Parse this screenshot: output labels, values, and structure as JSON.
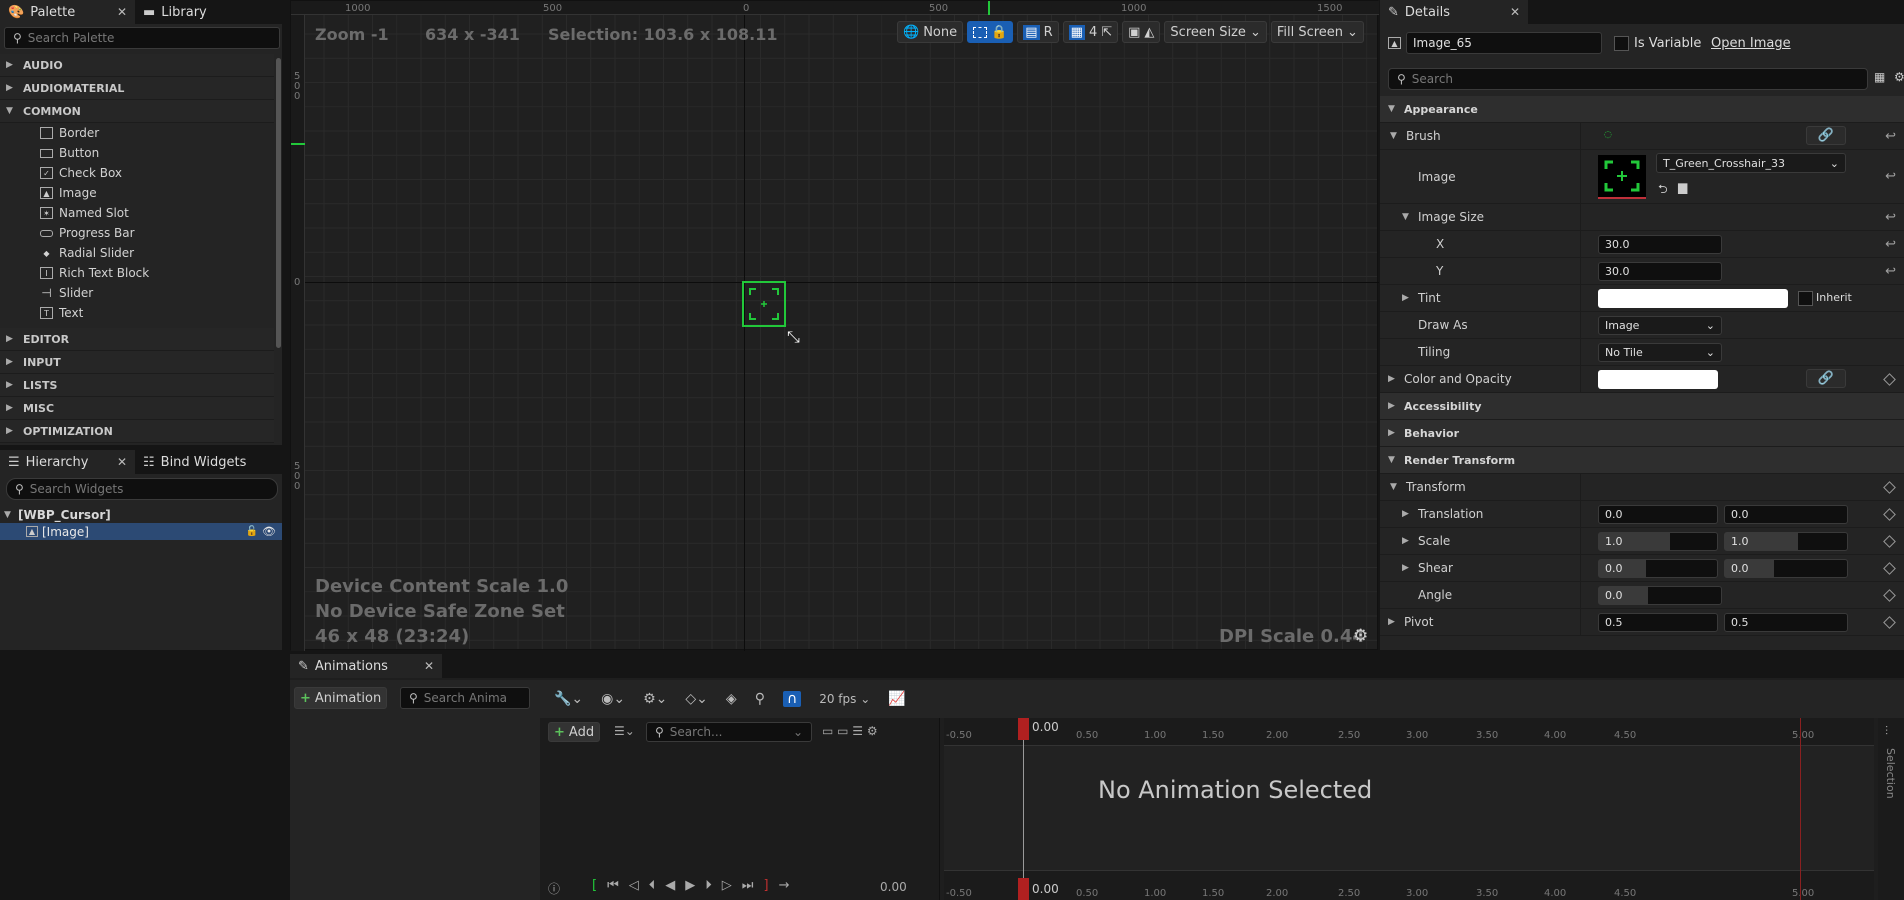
{
  "palette": {
    "tab_label": "Palette",
    "library_tab_label": "Library",
    "search_placeholder": "Search Palette",
    "categories_top": [
      "AUDIO",
      "AUDIOMATERIAL",
      "COMMON"
    ],
    "common_items": [
      {
        "label": "Border",
        "icon": "border-icon"
      },
      {
        "label": "Button",
        "icon": "button-icon"
      },
      {
        "label": "Check Box",
        "icon": "checkbox-icon"
      },
      {
        "label": "Image",
        "icon": "image-icon"
      },
      {
        "label": "Named Slot",
        "icon": "named-slot-icon"
      },
      {
        "label": "Progress Bar",
        "icon": "progress-bar-icon"
      },
      {
        "label": "Radial Slider",
        "icon": "radial-slider-icon"
      },
      {
        "label": "Rich Text Block",
        "icon": "rich-text-icon"
      },
      {
        "label": "Slider",
        "icon": "slider-icon"
      },
      {
        "label": "Text",
        "icon": "text-icon"
      }
    ],
    "categories_bottom": [
      "EDITOR",
      "INPUT",
      "LISTS",
      "MISC",
      "OPTIMIZATION"
    ]
  },
  "hierarchy": {
    "tab_label": "Hierarchy",
    "bind_tab_label": "Bind Widgets",
    "search_placeholder": "Search Widgets",
    "root": "[WBP_Cursor]",
    "child": "[Image]"
  },
  "viewport": {
    "zoom": "Zoom -1",
    "resolution": "634 x -341",
    "selection": "Selection: 103.6 x 108.11",
    "none_label": "None",
    "r_label": "R",
    "grid_snap": "4",
    "screen_size": "Screen Size",
    "fill_screen": "Fill Screen",
    "ruler_top": [
      "1000",
      "500",
      "0",
      "500",
      "1000",
      "1500"
    ],
    "ruler_left": [
      "5",
      "0",
      "0",
      "0",
      "5",
      "0",
      "0"
    ],
    "device_scale": "Device Content Scale 1.0",
    "safe_zone": "No Device Safe Zone Set",
    "size_info": "46 x 48 (23:24)",
    "dpi": "DPI Scale 0.44"
  },
  "details": {
    "tab_label": "Details",
    "name_value": "Image_65",
    "is_variable": "Is Variable",
    "open_image": "Open Image",
    "search_placeholder": "Search",
    "appearance": "Appearance",
    "brush": "Brush",
    "image_label": "Image",
    "image_asset": "T_Green_Crosshair_33",
    "image_size": "Image Size",
    "x_label": "X",
    "x_value": "30.0",
    "y_label": "Y",
    "y_value": "30.0",
    "tint": "Tint",
    "inherit": "Inherit",
    "draw_as": "Draw As",
    "draw_as_value": "Image",
    "tiling": "Tiling",
    "tiling_value": "No Tile",
    "color_opacity": "Color and Opacity",
    "accessibility": "Accessibility",
    "behavior": "Behavior",
    "render_transform": "Render Transform",
    "transform": "Transform",
    "translation": "Translation",
    "translation_x": "0.0",
    "translation_y": "0.0",
    "scale": "Scale",
    "scale_x": "1.0",
    "scale_y": "1.0",
    "shear": "Shear",
    "shear_x": "0.0",
    "shear_y": "0.0",
    "angle": "Angle",
    "angle_value": "0.0",
    "pivot": "Pivot",
    "pivot_x": "0.5",
    "pivot_y": "0.5"
  },
  "animations": {
    "tab_label": "Animations",
    "add_animation": "Animation",
    "search_placeholder": "Search Anima",
    "fps": "20 fps",
    "add_label": "Add",
    "track_search_placeholder": "Search...",
    "time_ticks": [
      "-0.50",
      "0.50",
      "1.00",
      "1.50",
      "2.00",
      "2.50",
      "3.00",
      "3.50",
      "4.00",
      "4.50",
      "5.00"
    ],
    "playhead_time": "0.00",
    "empty_message": "No Animation Selected",
    "current_time": "0.00",
    "selection_label": "Selection"
  },
  "colors": {
    "accent_blue": "#1a5fb4",
    "crosshair_green": "#22c83a",
    "playhead_red": "#b02020"
  }
}
